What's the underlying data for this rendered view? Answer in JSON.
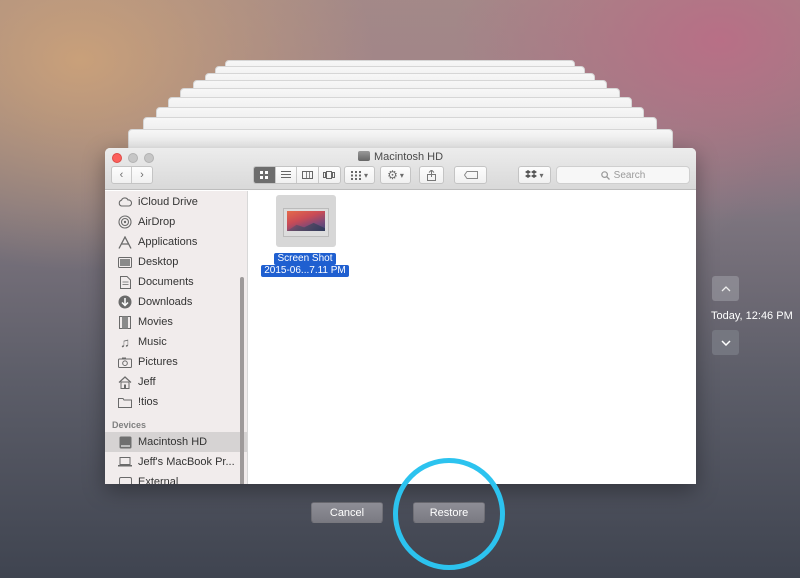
{
  "window": {
    "title": "Macintosh HD",
    "search_placeholder": "Search"
  },
  "sidebar": {
    "favorites": [
      {
        "label": "iCloud Drive",
        "icon": "cloud-icon"
      },
      {
        "label": "AirDrop",
        "icon": "airdrop-icon"
      },
      {
        "label": "Applications",
        "icon": "applications-icon"
      },
      {
        "label": "Desktop",
        "icon": "desktop-icon"
      },
      {
        "label": "Documents",
        "icon": "documents-icon"
      },
      {
        "label": "Downloads",
        "icon": "downloads-icon"
      },
      {
        "label": "Movies",
        "icon": "movies-icon"
      },
      {
        "label": "Music",
        "icon": "music-icon"
      },
      {
        "label": "Pictures",
        "icon": "pictures-icon"
      },
      {
        "label": "Jeff",
        "icon": "home-icon"
      },
      {
        "label": "!tios",
        "icon": "folder-icon"
      }
    ],
    "devices_header": "Devices",
    "devices": [
      {
        "label": "Macintosh HD",
        "icon": "hard-drive-icon",
        "selected": true
      },
      {
        "label": "Jeff's MacBook Pr...",
        "icon": "laptop-icon"
      },
      {
        "label": "External",
        "icon": "drive-icon"
      }
    ]
  },
  "files": [
    {
      "name_line1": "Screen Shot",
      "name_line2": "2015-06...7.11 PM",
      "selected": true
    }
  ],
  "time_machine": {
    "timestamp": "Today, 12:46 PM"
  },
  "buttons": {
    "cancel": "Cancel",
    "restore": "Restore"
  },
  "colors": {
    "selection": "#1f5fd0",
    "highlight_ring": "#2cc3ef",
    "close_button": "#fc605c"
  }
}
